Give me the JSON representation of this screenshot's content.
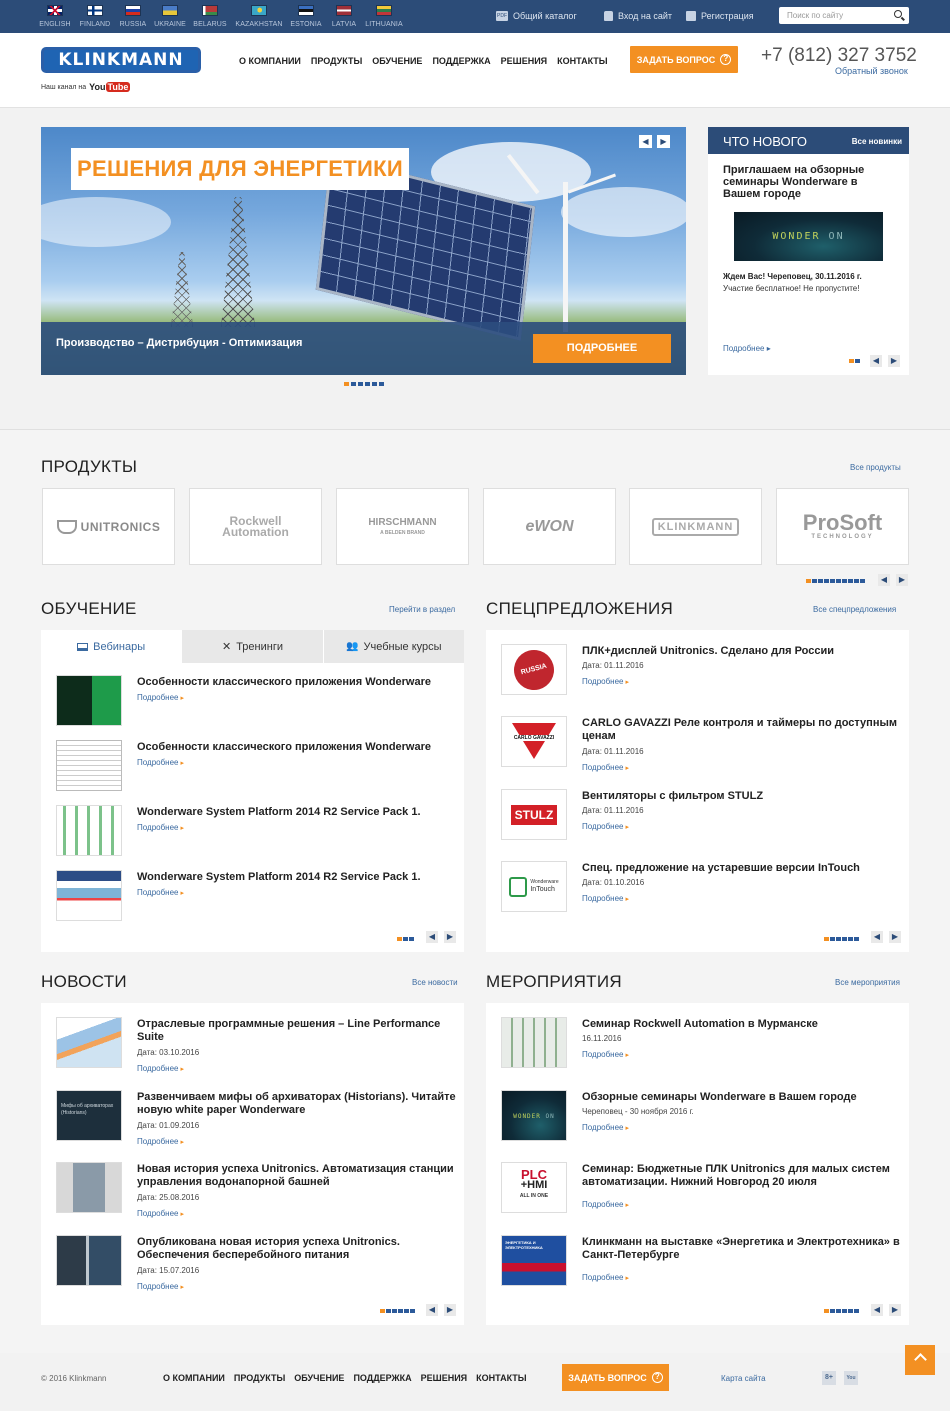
{
  "topbar": {
    "languages": [
      {
        "label": "ENGLISH",
        "icon": "flag-uk-icon"
      },
      {
        "label": "FINLAND",
        "icon": "flag-finland-icon"
      },
      {
        "label": "RUSSIA",
        "icon": "flag-russia-icon"
      },
      {
        "label": "UKRAINE",
        "icon": "flag-ukraine-icon"
      },
      {
        "label": "BELARUS",
        "icon": "flag-belarus-icon"
      },
      {
        "label": "KAZAKHSTAN",
        "icon": "flag-kazakhstan-icon"
      },
      {
        "label": "ESTONIA",
        "icon": "flag-estonia-icon"
      },
      {
        "label": "LATVIA",
        "icon": "flag-latvia-icon"
      },
      {
        "label": "LITHUANIA",
        "icon": "flag-lithuania-icon"
      }
    ],
    "catalog": "Общий каталог",
    "catalog_badge": "PDF",
    "login": "Вход на сайт",
    "register": "Регистрация",
    "search_placeholder": "Поиск по сайту"
  },
  "header": {
    "logo": "KLINKMANN",
    "youtube_prefix": "Наш канал на",
    "youtube_you": "You",
    "youtube_tube": "Tube",
    "nav": [
      "О КОМПАНИИ",
      "ПРОДУКТЫ",
      "ОБУЧЕНИЕ",
      "ПОДДЕРЖКА",
      "РЕШЕНИЯ",
      "КОНТАКТЫ"
    ],
    "ask": "ЗАДАТЬ ВОПРОС",
    "ask_icon": "?",
    "phone": "+7 (812) 327 3752",
    "callback": "Обратный звонок"
  },
  "hero": {
    "title": "РЕШЕНИЯ ДЛЯ ЭНЕРГЕТИКИ",
    "subtitle": "Производство – Дистрибуция - Оптимизация",
    "button": "ПОДРОБНЕЕ",
    "prev": "◀",
    "next": "▶"
  },
  "whats_new": {
    "title": "ЧТО НОВОГО",
    "all": "Все новинки",
    "item_title": "Приглашаем на обзорные семинары Wonderware в Вашем городе",
    "image_text_a": "WONDER",
    "image_text_b": "ON",
    "date_line": "Ждем Вас! Череповец, 30.11.2016 г.",
    "text": "Участие бесплатное! Не пропустите!",
    "more": "Подробнее ▸"
  },
  "products": {
    "title": "ПРОДУКТЫ",
    "all": "Все продукты",
    "brands": [
      "UNITRONICS",
      "Rockwell Automation",
      "HIRSCHMANN",
      "eWON",
      "KLINKMANN",
      "ProSoft"
    ],
    "hirschmann_sub": "A BELDEN BRAND",
    "prosoft_sub": "TECHNOLOGY"
  },
  "training": {
    "title": "ОБУЧЕНИЕ",
    "link": "Перейти в раздел",
    "tabs": [
      "Вебинары",
      "Тренинги",
      "Учебные курсы"
    ],
    "items": [
      {
        "title": "Особенности классического приложения Wonderware",
        "more": "Подробнее"
      },
      {
        "title": "Особенности классического приложения Wonderware",
        "more": "Подробнее"
      },
      {
        "title": "Wonderware System Platform 2014 R2 Service Pack 1.",
        "more": "Подробнее"
      },
      {
        "title": "Wonderware System Platform 2014 R2 Service Pack 1.",
        "more": "Подробнее"
      }
    ]
  },
  "offers": {
    "title": "СПЕЦПРЕДЛОЖЕНИЯ",
    "all": "Все спецпредложения",
    "items": [
      {
        "title": "ПЛК+дисплей Unitronics. Сделано для России",
        "date": "Дата: 01.11.2016",
        "more": "Подробнее"
      },
      {
        "title": "CARLO GAVAZZI Реле контроля и таймеры по доступным ценам",
        "date": "Дата: 01.11.2016",
        "more": "Подробнее"
      },
      {
        "title": "Вентиляторы с фильтром STULZ",
        "date": "Дата: 01.11.2016",
        "more": "Подробнее"
      },
      {
        "title": "Спец. предложение на устаревшие версии InTouch",
        "date": "Дата: 01.10.2016",
        "more": "Подробнее"
      }
    ],
    "thumb_russia": "RUSSIA",
    "thumb_carlo": "CARLO GAVAZZI",
    "thumb_stulz": "STULZ",
    "thumb_intouch_a": "Wonderware",
    "thumb_intouch_b": "InTouch"
  },
  "news": {
    "title": "НОВОСТИ",
    "all": "Все новости",
    "items": [
      {
        "title": "Отраслевые программные решения – Line Performance Suite",
        "date": "Дата: 03.10.2016",
        "more": "Подробнее"
      },
      {
        "title": "Развенчиваем мифы об архиваторах (Historians). Читайте новую white paper Wonderware",
        "date": "Дата: 01.09.2016",
        "more": "Подробнее"
      },
      {
        "title": "Новая история успеха Unitronics. Автоматизация станции управления водонапорной башней",
        "date": "Дата: 25.08.2016",
        "more": "Подробнее"
      },
      {
        "title": "Опубликована новая история успеха Unitronics. Обеспечения бесперебойного питания",
        "date": "Дата: 15.07.2016",
        "more": "Подробнее"
      }
    ],
    "thumb_myths": "Мифы об архиваторах (Historians)"
  },
  "events": {
    "title": "МЕРОПРИЯТИЯ",
    "all": "Все мероприятия",
    "items": [
      {
        "title": "Семинар Rockwell Automation в Мурманске",
        "date": "16.11.2016",
        "more": "Подробнее"
      },
      {
        "title": "Обзорные семинары Wonderware в Вашем городе",
        "date": "Череповец - 30 ноября 2016 г.",
        "more": "Подробнее"
      },
      {
        "title": "Семинар: Бюджетные ПЛК Unitronics для малых систем автоматизации. Нижний Новгород 20 июля",
        "date": "",
        "more": "Подробнее"
      },
      {
        "title": "Клинкманн на выставке «Энергетика и Электротехника» в Санкт-Петербурге",
        "date": "",
        "more": "Подробнее"
      }
    ],
    "thumb_plc_a": "PLC",
    "thumb_plc_b": "+HMI",
    "thumb_plc_c": "ALL IN ONE",
    "thumb_expo": "ЭНЕРГЕТИКА И ЭЛЕКТРОТЕХНИКА"
  },
  "footer": {
    "copyright": "© 2016 Klinkmann",
    "nav": [
      "О КОМПАНИИ",
      "ПРОДУКТЫ",
      "ОБУЧЕНИЕ",
      "ПОДДЕРЖКА",
      "РЕШЕНИЯ",
      "КОНТАКТЫ"
    ],
    "ask": "ЗАДАТЬ ВОПРОС",
    "sitemap": "Карта сайта",
    "gplus": "8+",
    "youtube": "You"
  },
  "colors": {
    "primary": "#2c4c78",
    "accent": "#f39022",
    "link": "#3b6aa0"
  }
}
